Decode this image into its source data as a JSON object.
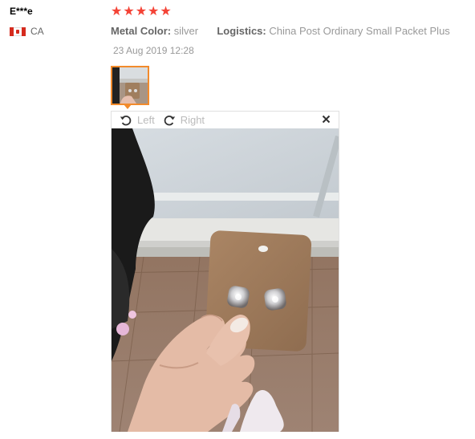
{
  "review": {
    "user": "E***e",
    "country_code": "CA",
    "rating": 5,
    "stars": [
      "★",
      "★",
      "★",
      "★",
      "★"
    ],
    "attributes": [
      {
        "label": "Metal Color:",
        "value": "silver"
      },
      {
        "label": "Logistics:",
        "value": "China Post Ordinary Small Packet Plus"
      }
    ],
    "date": "23 Aug 2019 12:28"
  },
  "viewer": {
    "rotate_left_label": "Left",
    "rotate_right_label": "Right",
    "close_label": "×"
  },
  "colors": {
    "star": "#f44336",
    "thumb_border": "#f28b2c",
    "flag_red": "#d52b1e"
  },
  "icons": {
    "rotate_left": "rotate-left-icon",
    "rotate_right": "rotate-right-icon",
    "close": "close-icon"
  }
}
